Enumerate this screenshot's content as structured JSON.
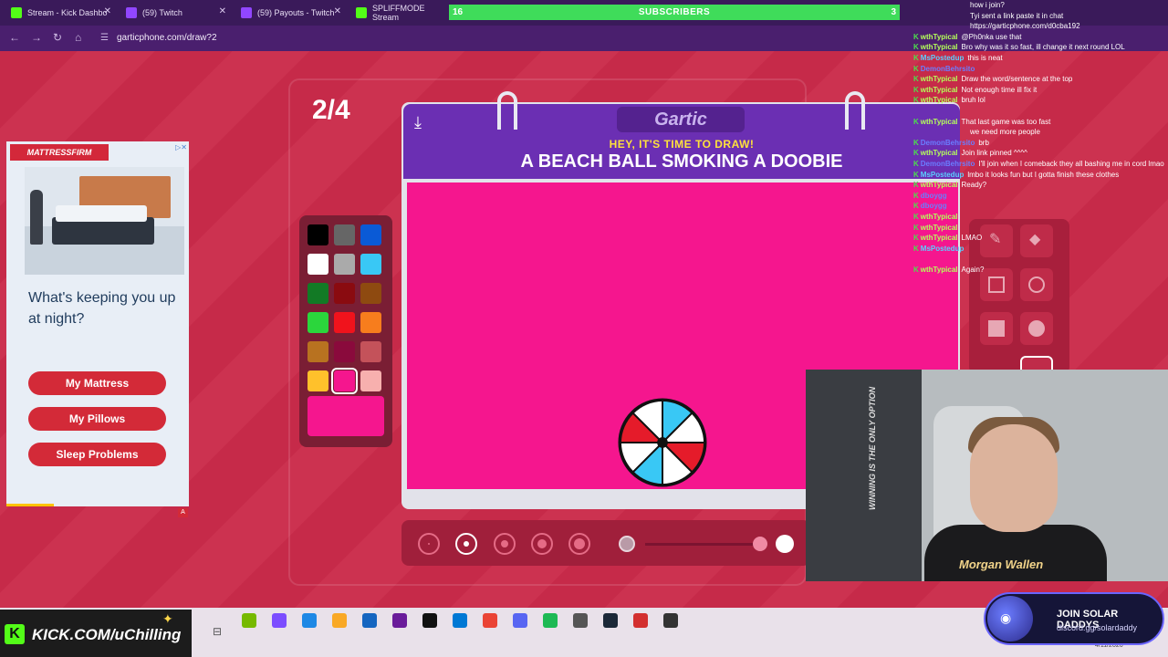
{
  "browser": {
    "tabs": [
      {
        "label": "Stream - Kick Dashbo",
        "icon_color": "#53fc18"
      },
      {
        "label": "(59) Twitch",
        "icon_color": "#9146ff"
      },
      {
        "label": "(59) Payouts - Twitch",
        "icon_color": "#9146ff"
      },
      {
        "label": "SPLIFFMODE Stream",
        "icon_color": "#53fc18"
      }
    ],
    "subscriber_bar": {
      "left": "16",
      "center": "SUBSCRIBERS",
      "right": "3"
    },
    "url": "garticphone.com/draw?2"
  },
  "ad": {
    "brand": "MATTRESSFIRM",
    "headline": "What's keeping you up at night?",
    "buttons": [
      "My Mattress",
      "My Pillows",
      "Sleep Problems"
    ]
  },
  "game": {
    "round": "2/4",
    "logo": "Gartic",
    "prompt_sub": "HEY, IT'S TIME TO DRAW!",
    "prompt_main": "A BEACH BALL SMOKING A DOOBIE",
    "selected_color": "#f5168e",
    "palette": [
      "#000000",
      "#666666",
      "#0a5ad6",
      "#ffffff",
      "#aaaaaa",
      "#39c8f5",
      "#127a25",
      "#8a0b10",
      "#8e4a10",
      "#2bd63c",
      "#f0131c",
      "#f77d1d",
      "#b87220",
      "#8a0a3c",
      "#c4525a",
      "#ffc12b",
      "#f5168e",
      "#f7b0ae"
    ]
  },
  "chat": [
    {
      "user": "",
      "msg": "how i join?"
    },
    {
      "user": "",
      "msg": "Tyi sent a link paste it in chat"
    },
    {
      "user": "",
      "msg": "https://garticphone.com/d0cba192"
    },
    {
      "user": "wthTypical",
      "msg": "@Ph0nka use that"
    },
    {
      "user": "wthTypical",
      "msg": "Bro why was it so fast, ill change it next round LOL"
    },
    {
      "user": "MsPostedup",
      "msg": "this is neat"
    },
    {
      "user": "DemonBehrsito",
      "msg": ""
    },
    {
      "user": "wthTypical",
      "msg": "Draw the word/sentence at the top"
    },
    {
      "user": "wthTypical",
      "msg": "Not enough time ill fix it"
    },
    {
      "user": "wthTypical",
      "msg": "bruh lol"
    },
    {
      "user": "",
      "msg": ""
    },
    {
      "user": "wthTypical",
      "msg": "That last game was too fast"
    },
    {
      "user": "",
      "msg": "we need more people"
    },
    {
      "user": "DemonBehrsito",
      "msg": "brb"
    },
    {
      "user": "wthTypical",
      "msg": "Join link pinned ^^^^"
    },
    {
      "user": "DemonBehrsito",
      "msg": "I'll join when I comeback they all bashing me in cord lmao"
    },
    {
      "user": "MsPostedup",
      "msg": "lmbo it looks fun but I gotta finish these clothes"
    },
    {
      "user": "wthTypical",
      "msg": "Ready?"
    },
    {
      "user": "dboygg",
      "msg": ""
    },
    {
      "user": "dboygg",
      "msg": ""
    },
    {
      "user": "wthTypical",
      "msg": ""
    },
    {
      "user": "wthTypical",
      "msg": ""
    },
    {
      "user": "wthTypical",
      "msg": "LMAO"
    },
    {
      "user": "MsPostedup",
      "msg": ""
    },
    {
      "user": "",
      "msg": ""
    },
    {
      "user": "wthTypical",
      "msg": "Again?"
    }
  ],
  "webcam": {
    "banner": "WINNING IS THE ONLY OPTION",
    "shirt": "Morgan Wallen"
  },
  "overlay": {
    "kick_url": "KICK.COM/uChilling",
    "discord_title": "JOIN SOLAR DADDYS",
    "discord_link": "discord.gg/solardaddy"
  },
  "taskbar": {
    "apps": [
      "nvidia",
      "copilot",
      "edge",
      "files",
      "store",
      "app",
      "tiktok",
      "mail",
      "chrome",
      "discord-alt",
      "spotify",
      "settings",
      "steam",
      "roblox",
      "obs"
    ],
    "date": "4/11/2026"
  }
}
